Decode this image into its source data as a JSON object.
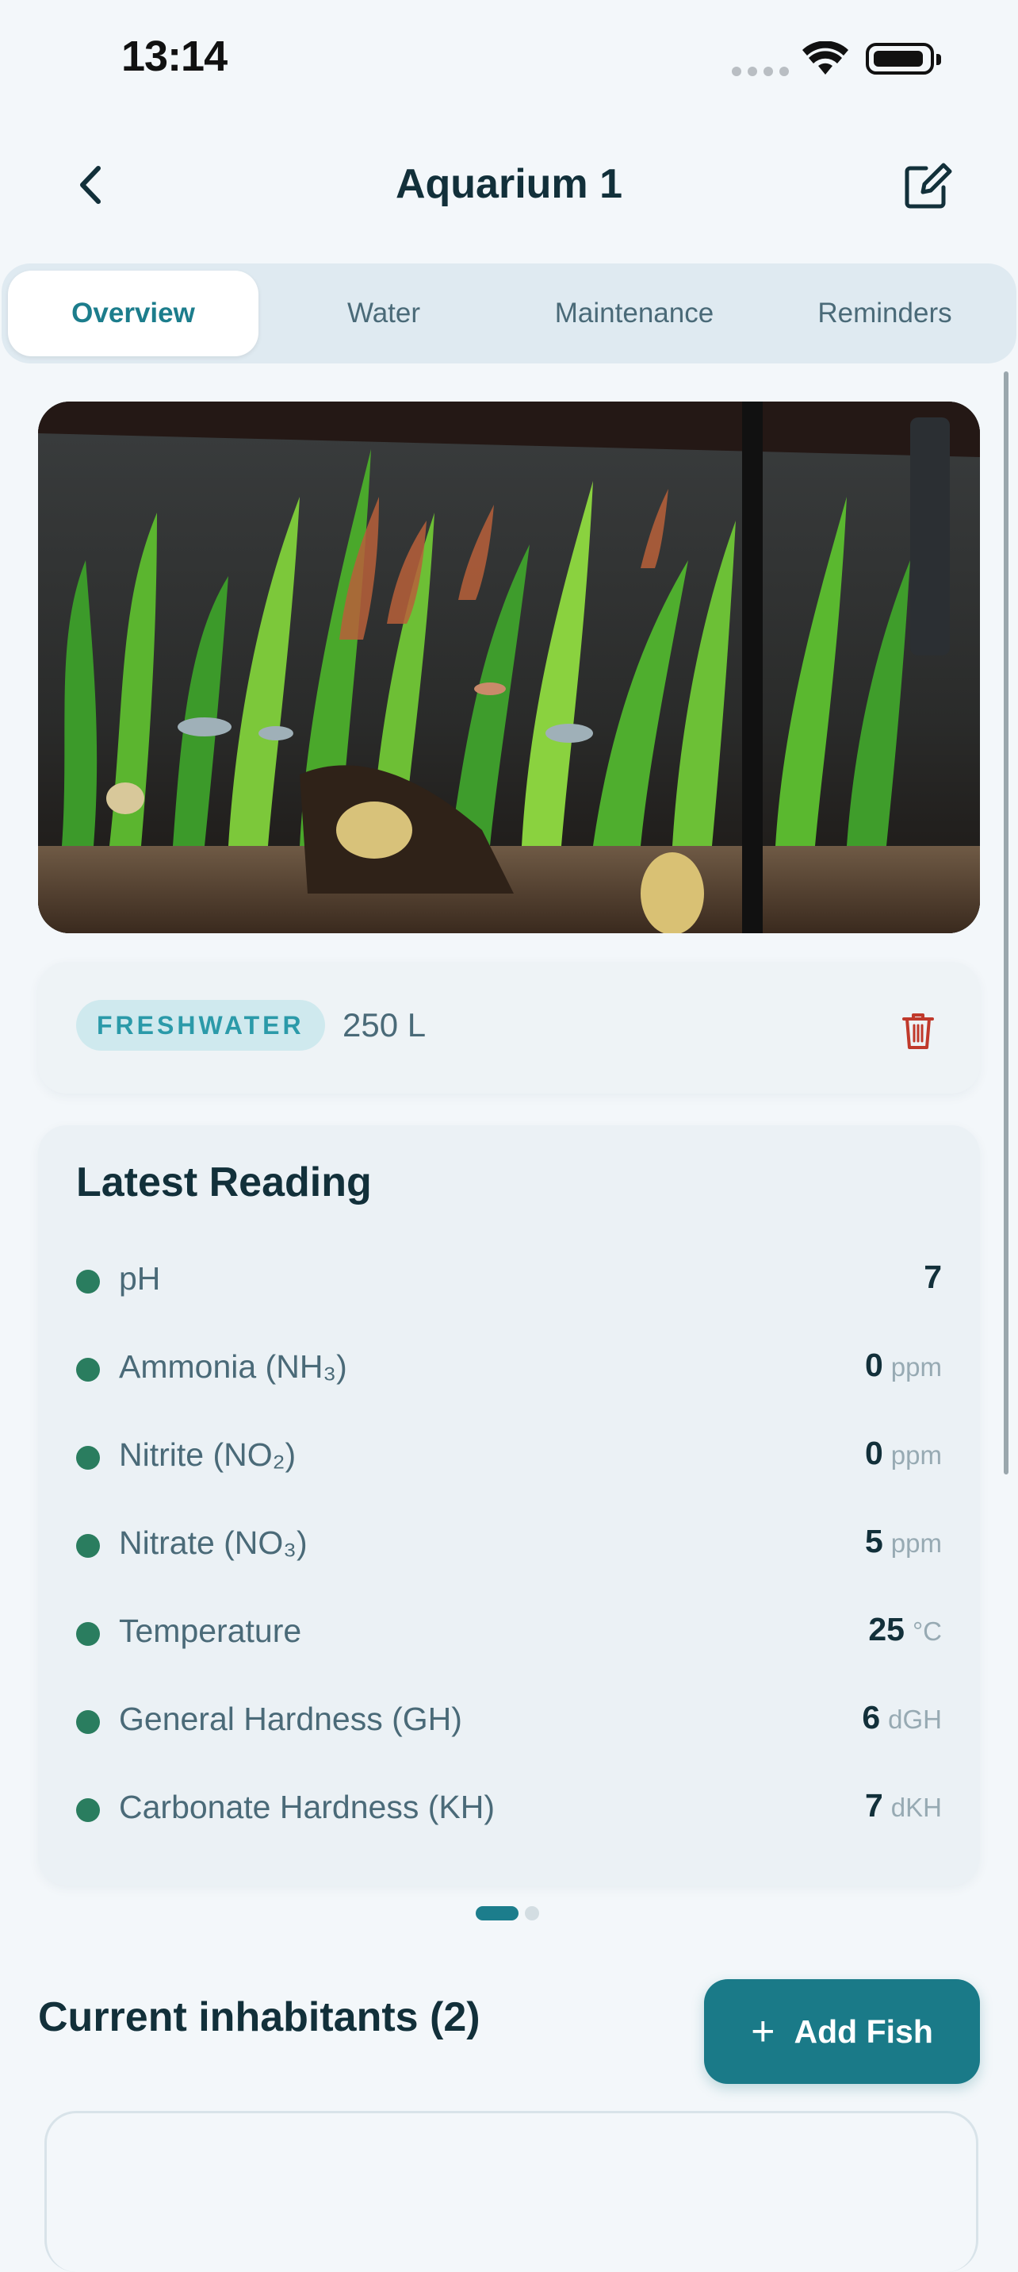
{
  "status_bar": {
    "time": "13:14"
  },
  "header": {
    "title": "Aquarium 1"
  },
  "tabs": [
    {
      "label": "Overview",
      "active": true
    },
    {
      "label": "Water",
      "active": false
    },
    {
      "label": "Maintenance",
      "active": false
    },
    {
      "label": "Reminders",
      "active": false
    }
  ],
  "tank": {
    "type_badge": "FRESHWATER",
    "volume": "250 L"
  },
  "latest_reading": {
    "title": "Latest Reading",
    "rows": [
      {
        "label": "pH",
        "value": "7",
        "unit": ""
      },
      {
        "label": "Ammonia (NH₃)",
        "value": "0",
        "unit": "ppm"
      },
      {
        "label": "Nitrite (NO₂)",
        "value": "0",
        "unit": "ppm"
      },
      {
        "label": "Nitrate (NO₃)",
        "value": "5",
        "unit": "ppm"
      },
      {
        "label": "Temperature",
        "value": "25",
        "unit": "°C"
      },
      {
        "label": "General Hardness (GH)",
        "value": "6",
        "unit": "dGH"
      },
      {
        "label": "Carbonate Hardness (KH)",
        "value": "7",
        "unit": "dKH"
      }
    ]
  },
  "pager": {
    "pages": 2,
    "current": 1
  },
  "inhabitants": {
    "title": "Current inhabitants (2)",
    "add_button": "Add Fish"
  },
  "colors": {
    "accent": "#1a7a88",
    "status_dot": "#2a7d5f",
    "badge_bg": "#cfe9ee",
    "delete": "#c0392b"
  },
  "icons": {
    "back": "chevron-left-icon",
    "edit": "edit-square-icon",
    "delete": "trash-icon",
    "add": "plus-icon"
  }
}
